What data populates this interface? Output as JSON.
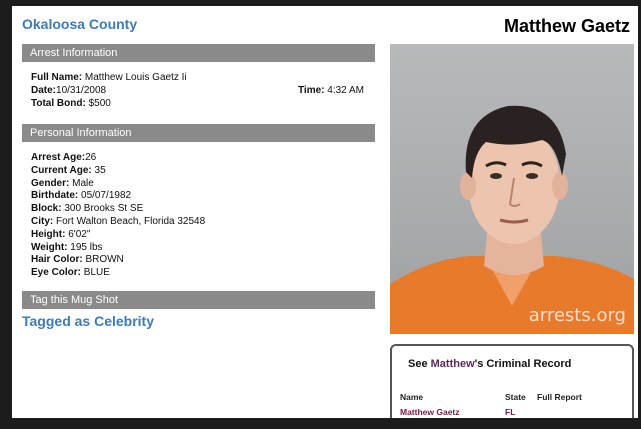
{
  "header": {
    "county": "Okaloosa County",
    "name": "Matthew Gaetz"
  },
  "arrest": {
    "section_title": "Arrest Information",
    "full_name_label": "Full Name:",
    "full_name": "Matthew Louis Gaetz Ii",
    "date_label": "Date:",
    "date": "10/31/2008",
    "time_label": "Time:",
    "time": "4:32 AM",
    "bond_label": "Total Bond:",
    "bond": "$500"
  },
  "personal": {
    "section_title": "Personal Information",
    "fields": [
      {
        "label": "Arrest Age:",
        "value": "26"
      },
      {
        "label": "Current Age:",
        "value": "35"
      },
      {
        "label": "Gender:",
        "value": "Male"
      },
      {
        "label": "Birthdate:",
        "value": "05/07/1982"
      },
      {
        "label": "Block:",
        "value": "300 Brooks St SE"
      },
      {
        "label": "City:",
        "value": "Fort Walton Beach, Florida 32548"
      },
      {
        "label": "Height:",
        "value": "6'02\""
      },
      {
        "label": "Weight:",
        "value": "195 lbs"
      },
      {
        "label": "Hair Color:",
        "value": "BROWN"
      },
      {
        "label": "Eye Color:",
        "value": "BLUE"
      }
    ]
  },
  "tag": {
    "section_title": "Tag this Mug Shot",
    "tagged_text": "Tagged as Celebrity"
  },
  "photo": {
    "watermark": "arrests.org"
  },
  "record": {
    "title_prefix": "See ",
    "title_name": "Matthew",
    "title_suffix": "'s Criminal Record",
    "columns": [
      "Name",
      "State",
      "Full Report"
    ],
    "rows": [
      {
        "name": "Matthew Gaetz",
        "state": "FL",
        "report": ""
      }
    ]
  },
  "colors": {
    "accent_blue": "#3d7bb3",
    "section_gray": "#8a8a8a",
    "orange_shirt": "#e87a2c"
  }
}
